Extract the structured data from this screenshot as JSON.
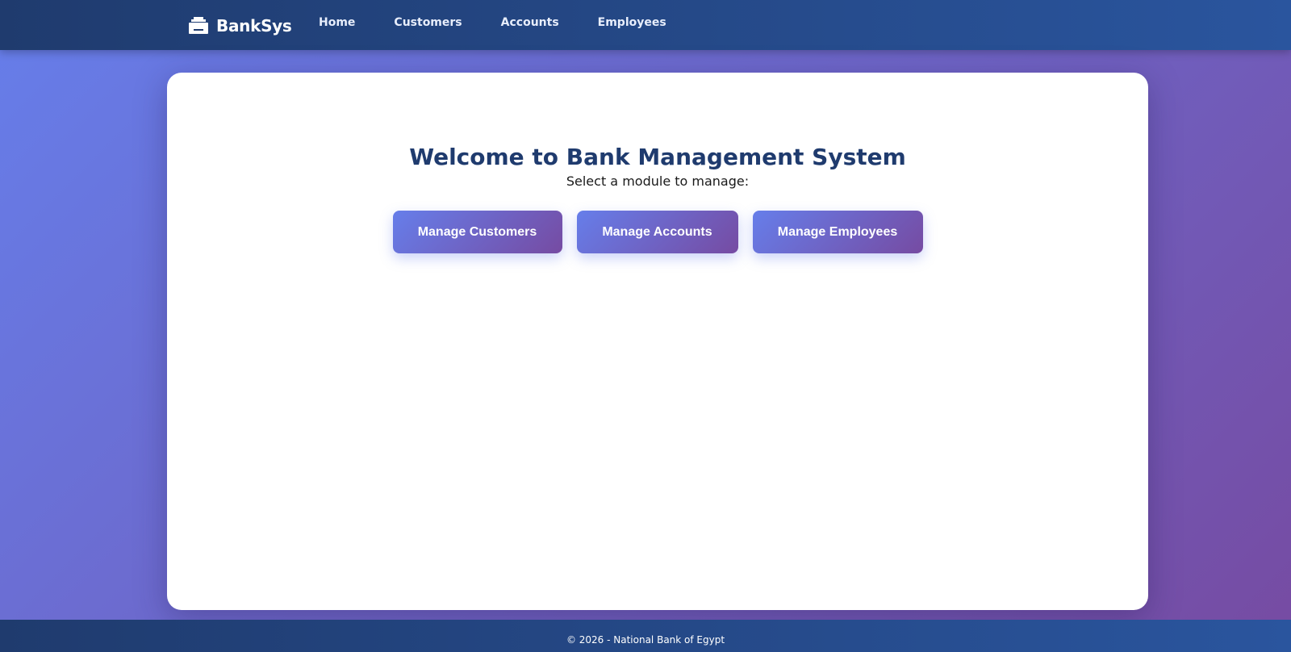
{
  "navbar": {
    "brand": {
      "icon": "bank-icon",
      "label": "BankSys"
    },
    "links": [
      {
        "label": "Home"
      },
      {
        "label": "Customers"
      },
      {
        "label": "Accounts"
      },
      {
        "label": "Employees"
      }
    ]
  },
  "main": {
    "title": "Welcome to Bank Management System",
    "subtitle": "Select a module to manage:",
    "buttons": {
      "customers": "Manage Customers",
      "accounts": "Manage Accounts",
      "employees": "Manage Employees"
    }
  },
  "footer": {
    "text": "© 2026 - National Bank of Egypt"
  },
  "colors": {
    "nav_start": "#1f3b6e",
    "nav_end": "#2a559e",
    "bg_start": "#667eea",
    "bg_end": "#764ba2",
    "title": "#1f3b6e"
  }
}
